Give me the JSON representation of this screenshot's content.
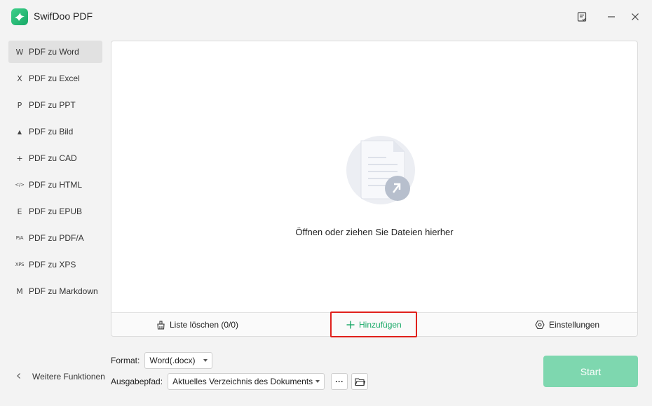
{
  "app": {
    "title": "SwifDoo PDF"
  },
  "sidebar": {
    "items": [
      {
        "icon": "W",
        "icon_name": "word-icon",
        "label": "PDF zu Word",
        "active": true
      },
      {
        "icon": "X",
        "icon_name": "excel-icon",
        "label": "PDF zu Excel"
      },
      {
        "icon": "P",
        "icon_name": "ppt-icon",
        "label": "PDF zu PPT"
      },
      {
        "icon": "▲",
        "icon_name": "image-icon",
        "label": "PDF zu Bild"
      },
      {
        "icon": "+",
        "icon_name": "cad-icon",
        "label": "PDF zu CAD"
      },
      {
        "icon": "</>",
        "icon_name": "html-icon",
        "label": "PDF zu HTML"
      },
      {
        "icon": "E",
        "icon_name": "epub-icon",
        "label": "PDF zu EPUB"
      },
      {
        "icon": "P/A",
        "icon_name": "pdfa-icon",
        "label": "PDF zu PDF/A"
      },
      {
        "icon": "XPS",
        "icon_name": "xps-icon",
        "label": "PDF zu XPS"
      },
      {
        "icon": "M",
        "icon_name": "markdown-icon",
        "label": "PDF zu Markdown"
      }
    ],
    "more_functions": "Weitere Funktionen"
  },
  "drop_zone": {
    "text": "Öffnen oder ziehen Sie Dateien hierher"
  },
  "footer": {
    "clear_list": "Liste löschen (0/0)",
    "add": "Hinzufügen",
    "settings": "Einstellungen"
  },
  "options": {
    "format_label": "Format:",
    "format_value": "Word(.docx)",
    "output_label": "Ausgabepfad:",
    "output_value": "Aktuelles Verzeichnis des Dokuments",
    "more_button": "···"
  },
  "start": {
    "label": "Start"
  },
  "colors": {
    "accent": "#17a866",
    "start_disabled": "#7ed7af",
    "highlight": "#e0201c"
  }
}
